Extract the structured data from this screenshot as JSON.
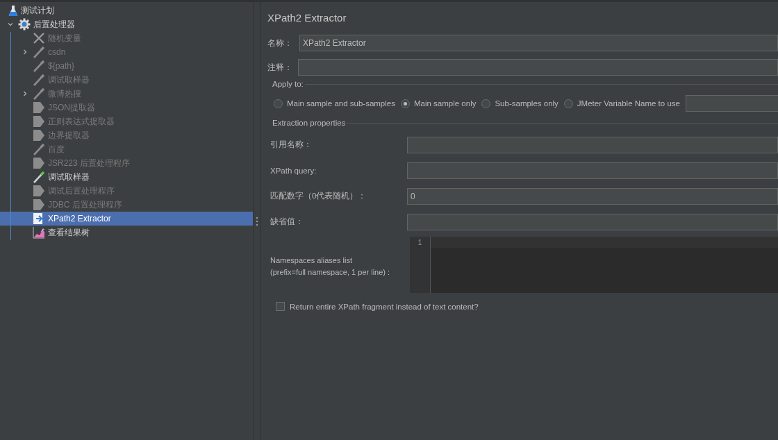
{
  "tree": [
    {
      "label": "测试计划",
      "kind": "flask",
      "disabled": false,
      "selected": false,
      "children": [
        {
          "label": "后置处理器",
          "kind": "gear",
          "expanded": true,
          "disabled": false,
          "selected": false,
          "children": [
            {
              "label": "随机变量",
              "kind": "tools",
              "disabled": true,
              "selected": false
            },
            {
              "label": "csdn",
              "kind": "sampler",
              "expanded": false,
              "disabled": true,
              "selected": false
            },
            {
              "label": "${path}",
              "kind": "sampler",
              "disabled": true,
              "selected": false
            },
            {
              "label": "调试取样器",
              "kind": "sampler",
              "disabled": true,
              "selected": false
            },
            {
              "label": "微博热搜",
              "kind": "sampler",
              "expanded": false,
              "disabled": true,
              "selected": false
            },
            {
              "label": "JSON提取器",
              "kind": "extractor",
              "disabled": true,
              "selected": false
            },
            {
              "label": "正则表达式提取器",
              "kind": "extractor",
              "disabled": true,
              "selected": false
            },
            {
              "label": "边界提取器",
              "kind": "extractor",
              "disabled": true,
              "selected": false
            },
            {
              "label": "百度",
              "kind": "sampler",
              "disabled": true,
              "selected": false
            },
            {
              "label": "JSR223 后置处理程序",
              "kind": "extractor",
              "disabled": true,
              "selected": false
            },
            {
              "label": "调试取样器",
              "kind": "sampler",
              "disabled": false,
              "selected": false
            },
            {
              "label": "调试后置处理程序",
              "kind": "extractor",
              "disabled": true,
              "selected": false
            },
            {
              "label": "JDBC 后置处理程序",
              "kind": "extractor",
              "disabled": true,
              "selected": false
            },
            {
              "label": "XPath2 Extractor",
              "kind": "xpath",
              "disabled": false,
              "selected": true
            },
            {
              "label": "查看结果树",
              "kind": "listener",
              "disabled": false,
              "selected": false
            }
          ]
        }
      ]
    }
  ],
  "panel": {
    "title": "XPath2 Extractor",
    "name": {
      "label": "名称：",
      "value": "XPath2 Extractor"
    },
    "comment": {
      "label": "注释："
    },
    "apply_to": {
      "legend": "Apply to:",
      "options": [
        {
          "label": "Main sample and sub-samples",
          "selected": false
        },
        {
          "label": "Main sample only",
          "selected": true
        },
        {
          "label": "Sub-samples only",
          "selected": false
        },
        {
          "label": "JMeter Variable Name to use",
          "selected": false
        }
      ]
    },
    "extraction": {
      "legend": "Extraction properties",
      "fields": [
        {
          "kind": "text",
          "label": "引用名称："
        },
        {
          "kind": "text",
          "label": "XPath query:"
        },
        {
          "kind": "text",
          "label": "匹配数字（0代表随机）：",
          "value": "0"
        },
        {
          "kind": "text",
          "label": "缺省值："
        },
        {
          "kind": "code",
          "label": "Namespaces aliases list\n(prefix=full namespace, 1 per line) :",
          "line_numbers": [
            "1"
          ]
        }
      ]
    },
    "fragment": {
      "label": "Return entire XPath fragment instead of text content?",
      "checked": false
    }
  }
}
